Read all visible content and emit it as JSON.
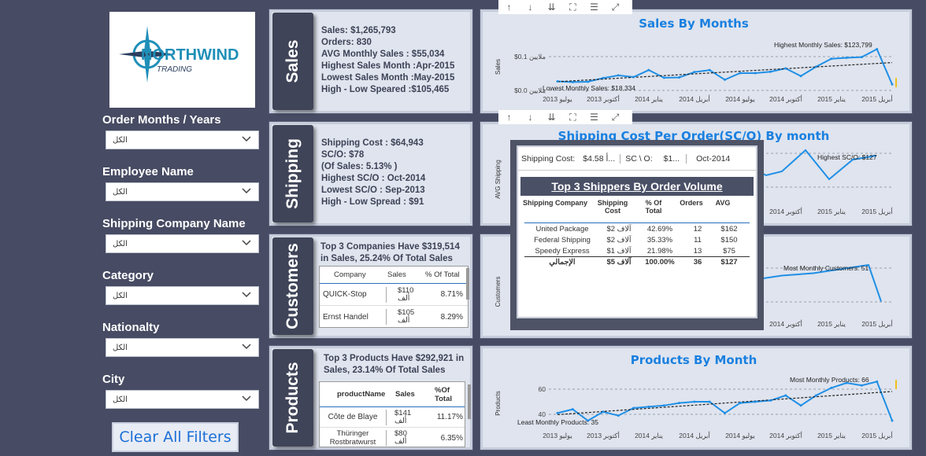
{
  "logo": {
    "text_main": "NORTHWIND",
    "text_sub": "TRADING"
  },
  "filters": [
    {
      "label": "Order Months / Years",
      "value": "الكل"
    },
    {
      "label": "Employee Name",
      "value": "الكل"
    },
    {
      "label": "Shipping Company Name",
      "value": "الكل"
    },
    {
      "label": "Category",
      "value": "الكل"
    },
    {
      "label": "Nationalty",
      "value": "الكل"
    },
    {
      "label": "City",
      "value": "الكل"
    }
  ],
  "clear_filters": "Clear All Filters",
  "tabs": {
    "sales": "Sales",
    "shipping": "Shipping",
    "customers": "Customers",
    "products": "Products"
  },
  "sales_kpis": [
    "Sales: $1,265,793",
    "Orders: 830",
    "AVG Monthly Sales : $55,034",
    "Highest Sales Month :Apr-2015",
    "Lowest Sales Month :May-2015",
    "High - Low Speared :$105,465"
  ],
  "shipping_kpis": [
    "Shipping Cost : $64,943",
    "SC/O: $78",
    "(Of Sales:  5.13% )",
    "Highest SC/O : Oct-2014",
    "Lowest SC/O : Sep-2013",
    "High - Low Spread : $91"
  ],
  "customers": {
    "heading": "Top 3 Companies Have $319,514 in Sales, 25.24% Of Total Sales",
    "columns": [
      "Company",
      "Sales",
      "% Of Total"
    ],
    "rows": [
      {
        "name": "QUICK-Stop",
        "sales": "$110",
        "unit": "ألف",
        "pct": "8.71%"
      },
      {
        "name": "Ernst Handel",
        "sales": "$105",
        "unit": "ألف",
        "pct": "8.29%"
      }
    ]
  },
  "products": {
    "heading": "Top 3 Products Have $292,921 in Sales, 23.14% Of Total Sales",
    "columns": [
      "productName",
      "Sales",
      "%Of Total"
    ],
    "rows": [
      {
        "name": "Côte de Blaye",
        "sales": "$141",
        "unit": "ألف",
        "pct": "11.17%"
      },
      {
        "name": "Thüringer Rostbratwurst",
        "sales": "$80",
        "unit": "ألف",
        "pct": "6.35%"
      }
    ]
  },
  "toolbar_icons": [
    "arrow-up-icon",
    "arrow-down-icon",
    "double-arrow-down-icon",
    "hierarchy-icon",
    "filter-icon",
    "expand-icon"
  ],
  "months_axis": [
    "يوليو 2013",
    "أكتوبر 2013",
    "يناير 2014",
    "أبريل 2014",
    "يوليو 2014",
    "أكتوبر 2014",
    "يناير 2015",
    "أبريل 2015"
  ],
  "charts": {
    "sales": {
      "title": "Sales By Months",
      "ylabel": "Sales",
      "yticks": [
        "$0.1 ملايين",
        "$0.0 ملايين"
      ],
      "high": "Highest Monthly Sales: $123,799",
      "low": "Lowest Monthly Sales: $18,334"
    },
    "shipping": {
      "title": "Shipping Cost Per Order(SC/O) By month",
      "ylabel": "AVG Shipping",
      "high": "Highest SC/O: $127"
    },
    "customers": {
      "ylabel": "Customers",
      "high": "Most Monthly Customers: 51"
    },
    "products": {
      "title": "Products By Month",
      "ylabel": "Products",
      "yticks": [
        "60",
        "40"
      ],
      "high": "Most Monthly Products: 66",
      "low": "Least Monthly Products: 35"
    }
  },
  "chart_data": [
    {
      "type": "line",
      "title": "Sales By Months",
      "ylabel": "Sales",
      "x": [
        "2013-07",
        "2013-08",
        "2013-09",
        "2013-10",
        "2013-11",
        "2013-12",
        "2014-01",
        "2014-02",
        "2014-03",
        "2014-04",
        "2014-05",
        "2014-06",
        "2014-07",
        "2014-08",
        "2014-09",
        "2014-10",
        "2014-11",
        "2014-12",
        "2015-01",
        "2015-02",
        "2015-03",
        "2015-04",
        "2015-05"
      ],
      "series": [
        {
          "values": [
            27000,
            25000,
            26000,
            37000,
            45000,
            40000,
            61000,
            38000,
            39000,
            55000,
            61000,
            32000,
            52000,
            52000,
            56000,
            66000,
            43000,
            71000,
            95000,
            98000,
            100000,
            123799,
            18334
          ]
        }
      ]
    },
    {
      "type": "line",
      "title": "Products By Month",
      "ylabel": "Products",
      "ylim": [
        30,
        70
      ],
      "x": [
        "2013-07",
        "2013-08",
        "2013-09",
        "2013-10",
        "2013-11",
        "2013-12",
        "2014-01",
        "2014-02",
        "2014-03",
        "2014-04",
        "2014-05",
        "2014-06",
        "2014-07",
        "2014-08",
        "2014-09",
        "2014-10",
        "2014-11",
        "2014-12",
        "2015-01",
        "2015-02",
        "2015-03",
        "2015-04",
        "2015-05"
      ],
      "series": [
        {
          "values": [
            41,
            44,
            35,
            42,
            39,
            45,
            46,
            47,
            49,
            50,
            50,
            41,
            49,
            50,
            51,
            55,
            47,
            55,
            61,
            65,
            63,
            66,
            35
          ]
        }
      ]
    }
  ],
  "tooltip": {
    "header": [
      {
        "label": "Shipping Cost:",
        "value": "$4.58 أ..."
      },
      {
        "label": "SC \\ O:",
        "value": "$1..."
      },
      {
        "label": "",
        "value": "Oct-2014"
      }
    ],
    "title": "Top 3 Shippers By Order Volume",
    "columns": [
      "Shipping Company",
      "Shipping Cost",
      "% Of Total",
      "Orders",
      "AVG"
    ],
    "rows": [
      {
        "company": "United Package",
        "cost": "$2 آلاف",
        "pct": "42.69%",
        "orders": "12",
        "avg": "$162"
      },
      {
        "company": "Federal Shipping",
        "cost": "$2 آلاف",
        "pct": "35.33%",
        "orders": "11",
        "avg": "$150"
      },
      {
        "company": "Speedy Express",
        "cost": "$1 آلاف",
        "pct": "21.98%",
        "orders": "13",
        "avg": "$75"
      }
    ],
    "total": {
      "company": "الإجمالي",
      "cost": "$5 آلاف",
      "pct": "100.00%",
      "orders": "36",
      "avg": "$127"
    }
  }
}
